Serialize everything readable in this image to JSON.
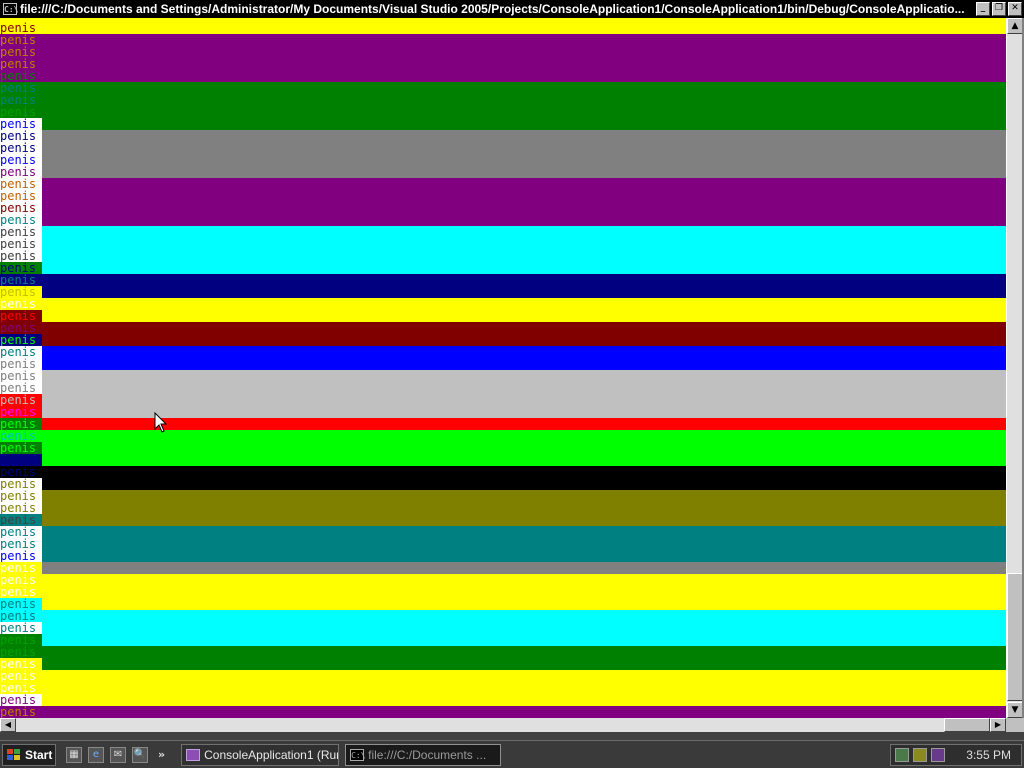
{
  "window": {
    "title": "file:///C:/Documents and Settings/Administrator/My Documents/Visual Studio 2005/Projects/ConsoleApplication1/ConsoleApplication1/bin/Debug/ConsoleApplicatio...",
    "icon_text": "C:\\",
    "minimize_glyph": "_",
    "restore_glyph": "❐",
    "close_glyph": "✕"
  },
  "console": {
    "word": "penis",
    "bands": [
      {
        "color": "#ffff00",
        "lines": 1
      },
      {
        "color": "#800080",
        "lines": 4
      },
      {
        "color": "#008000",
        "lines": 4
      },
      {
        "color": "#808080",
        "lines": 4
      },
      {
        "color": "#800080",
        "lines": 4
      },
      {
        "color": "#00ffff",
        "lines": 4
      },
      {
        "color": "#000080",
        "lines": 2
      },
      {
        "color": "#ffff00",
        "lines": 2
      },
      {
        "color": "#800000",
        "lines": 2
      },
      {
        "color": "#0000ff",
        "lines": 2
      },
      {
        "color": "#c0c0c0",
        "lines": 4
      },
      {
        "color": "#ff0000",
        "lines": 1
      },
      {
        "color": "#00ff00",
        "lines": 3
      },
      {
        "color": "#000000",
        "lines": 2
      },
      {
        "color": "#808000",
        "lines": 3
      },
      {
        "color": "#008080",
        "lines": 3
      },
      {
        "color": "#808080",
        "lines": 1
      },
      {
        "color": "#ffff00",
        "lines": 3
      },
      {
        "color": "#00ffff",
        "lines": 3
      },
      {
        "color": "#008000",
        "lines": 2
      },
      {
        "color": "#ffff00",
        "lines": 3
      },
      {
        "color": "#800080",
        "lines": 2
      }
    ],
    "lines": [
      {
        "bg": "#ffff00",
        "fg": "#800000"
      },
      {
        "bg": "#800080",
        "fg": "#c08000"
      },
      {
        "bg": "#800080",
        "fg": "#c08000"
      },
      {
        "bg": "#800080",
        "fg": "#c08000"
      },
      {
        "bg": "#800080",
        "fg": "#008000"
      },
      {
        "bg": "#008000",
        "fg": "#008080"
      },
      {
        "bg": "#008000",
        "fg": "#008080"
      },
      {
        "bg": "#008000",
        "fg": "#00a000"
      },
      {
        "bg": "#ffffff",
        "fg": "#0000ff"
      },
      {
        "bg": "#ffffff",
        "fg": "#000080"
      },
      {
        "bg": "#ffffff",
        "fg": "#000080"
      },
      {
        "bg": "#ffffff",
        "fg": "#0000ff"
      },
      {
        "bg": "#ffffff",
        "fg": "#800080"
      },
      {
        "bg": "#ffffff",
        "fg": "#c06000"
      },
      {
        "bg": "#ffffff",
        "fg": "#c06000"
      },
      {
        "bg": "#ffffff",
        "fg": "#800000"
      },
      {
        "bg": "#ffffff",
        "fg": "#008080"
      },
      {
        "bg": "#ffffff",
        "fg": "#404040"
      },
      {
        "bg": "#ffffff",
        "fg": "#404040"
      },
      {
        "bg": "#ffffff",
        "fg": "#404040"
      },
      {
        "bg": "#008000",
        "fg": "#000080"
      },
      {
        "bg": "#000080",
        "fg": "#008080"
      },
      {
        "bg": "#ffff00",
        "fg": "#c0c000"
      },
      {
        "bg": "#ffff00",
        "fg": "#ffffff"
      },
      {
        "bg": "#800000",
        "fg": "#ff0000"
      },
      {
        "bg": "#800000",
        "fg": "#800080"
      },
      {
        "bg": "#000080",
        "fg": "#00ff00"
      },
      {
        "bg": "#ffffff",
        "fg": "#008080"
      },
      {
        "bg": "#ffffff",
        "fg": "#808080"
      },
      {
        "bg": "#ffffff",
        "fg": "#808080"
      },
      {
        "bg": "#ffffff",
        "fg": "#808080"
      },
      {
        "bg": "#ff0000",
        "fg": "#c0c0c0"
      },
      {
        "bg": "#ff0000",
        "fg": "#ff00ff"
      },
      {
        "bg": "#008000",
        "fg": "#00ff00"
      },
      {
        "bg": "#00ff00",
        "fg": "#00c0c0"
      },
      {
        "bg": "#008000",
        "fg": "#00ff00"
      },
      {
        "bg": "#000080",
        "fg": "#000080"
      },
      {
        "bg": "#000000",
        "fg": "#000080"
      },
      {
        "bg": "#ffffff",
        "fg": "#808000"
      },
      {
        "bg": "#ffffff",
        "fg": "#808000"
      },
      {
        "bg": "#ffffff",
        "fg": "#808000"
      },
      {
        "bg": "#008080",
        "fg": "#404040"
      },
      {
        "bg": "#ffffff",
        "fg": "#008080"
      },
      {
        "bg": "#ffffff",
        "fg": "#008080"
      },
      {
        "bg": "#ffffff",
        "fg": "#0000ff"
      },
      {
        "bg": "#ffff00",
        "fg": "#ffffff"
      },
      {
        "bg": "#ffff00",
        "fg": "#ffffff"
      },
      {
        "bg": "#ffff00",
        "fg": "#ffffff"
      },
      {
        "bg": "#00ffff",
        "fg": "#008080"
      },
      {
        "bg": "#00ffff",
        "fg": "#008080"
      },
      {
        "bg": "#ffffff",
        "fg": "#008080"
      },
      {
        "bg": "#008000",
        "fg": "#00a000"
      },
      {
        "bg": "#008000",
        "fg": "#00a000"
      },
      {
        "bg": "#ffff00",
        "fg": "#ffffff"
      },
      {
        "bg": "#ffff00",
        "fg": "#ffffff"
      },
      {
        "bg": "#ffff00",
        "fg": "#ffffff"
      },
      {
        "bg": "#ffffff",
        "fg": "#800080"
      },
      {
        "bg": "#800080",
        "fg": "#c08000"
      }
    ]
  },
  "scrollbars": {
    "up": "▲",
    "down": "▼",
    "left": "◀",
    "right": "▶"
  },
  "taskbar": {
    "start_label": "Start",
    "quick_launch": [
      "desktop-icon",
      "ie-icon",
      "outlook-icon",
      "search-icon"
    ],
    "quick_launch_glyphs": [
      "▦",
      "e",
      "✉",
      "🔍"
    ],
    "chevron": "»",
    "tasks": [
      {
        "label": "ConsoleApplication1 (Run...",
        "active": false
      },
      {
        "label": "file:///C:/Documents ...",
        "active": true
      }
    ],
    "clock": "3:55 PM"
  }
}
